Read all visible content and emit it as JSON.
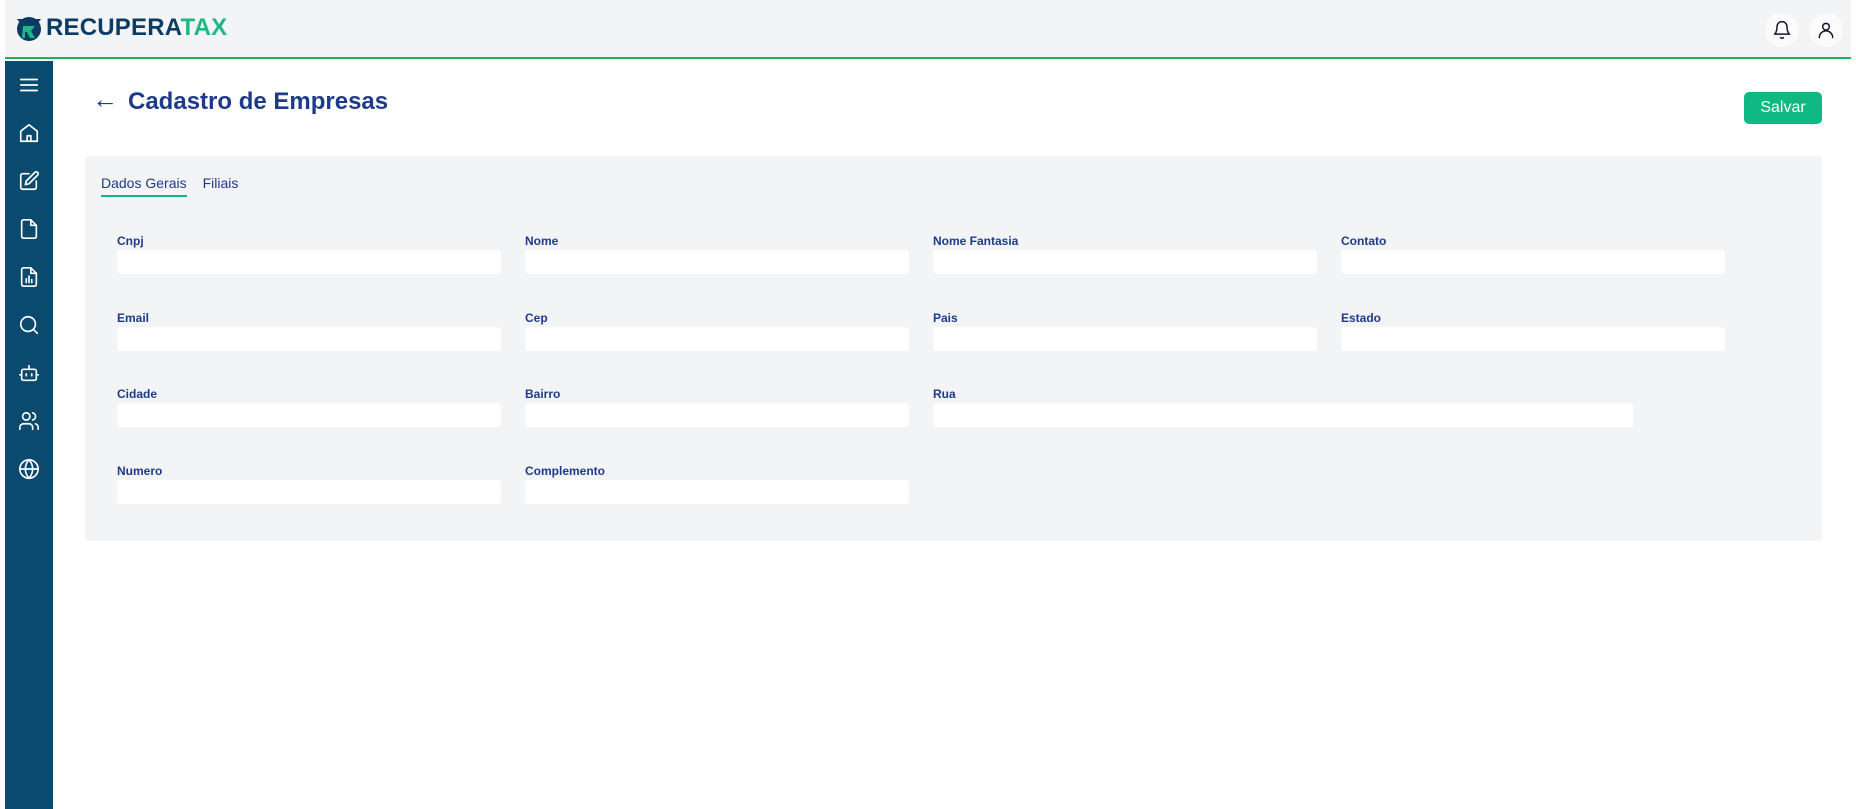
{
  "brand": {
    "part1": "RECUPERA",
    "part2": "TAX"
  },
  "header": {
    "notifications_icon": "bell-icon",
    "user_icon": "user-icon"
  },
  "sidebar": {
    "items": [
      {
        "name": "menu",
        "icon": "menu-icon"
      },
      {
        "name": "home",
        "icon": "home-icon"
      },
      {
        "name": "edit",
        "icon": "edit-icon"
      },
      {
        "name": "document",
        "icon": "file-icon"
      },
      {
        "name": "report",
        "icon": "report-icon"
      },
      {
        "name": "search",
        "icon": "search-icon"
      },
      {
        "name": "robot",
        "icon": "robot-icon"
      },
      {
        "name": "users",
        "icon": "users-icon"
      },
      {
        "name": "globe",
        "icon": "globe-icon"
      }
    ]
  },
  "page": {
    "title": "Cadastro de Empresas",
    "back_symbol": "←",
    "save_label": "Salvar"
  },
  "tabs": [
    {
      "label": "Dados Gerais",
      "active": true
    },
    {
      "label": "Filiais",
      "active": false
    }
  ],
  "form": {
    "cnpj": {
      "label": "Cnpj",
      "value": ""
    },
    "nome": {
      "label": "Nome",
      "value": ""
    },
    "nome_fantasia": {
      "label": "Nome Fantasia",
      "value": ""
    },
    "contato": {
      "label": "Contato",
      "value": ""
    },
    "email": {
      "label": "Email",
      "value": ""
    },
    "cep": {
      "label": "Cep",
      "value": ""
    },
    "pais": {
      "label": "Pais",
      "value": ""
    },
    "estado": {
      "label": "Estado",
      "value": ""
    },
    "cidade": {
      "label": "Cidade",
      "value": ""
    },
    "bairro": {
      "label": "Bairro",
      "value": ""
    },
    "rua": {
      "label": "Rua",
      "value": ""
    },
    "numero": {
      "label": "Numero",
      "value": ""
    },
    "complemento": {
      "label": "Complemento",
      "value": ""
    }
  },
  "colors": {
    "sidebar": "#0a4a6e",
    "accent": "#10b981",
    "title": "#1e3a8a",
    "panel": "#f3f4f6"
  }
}
